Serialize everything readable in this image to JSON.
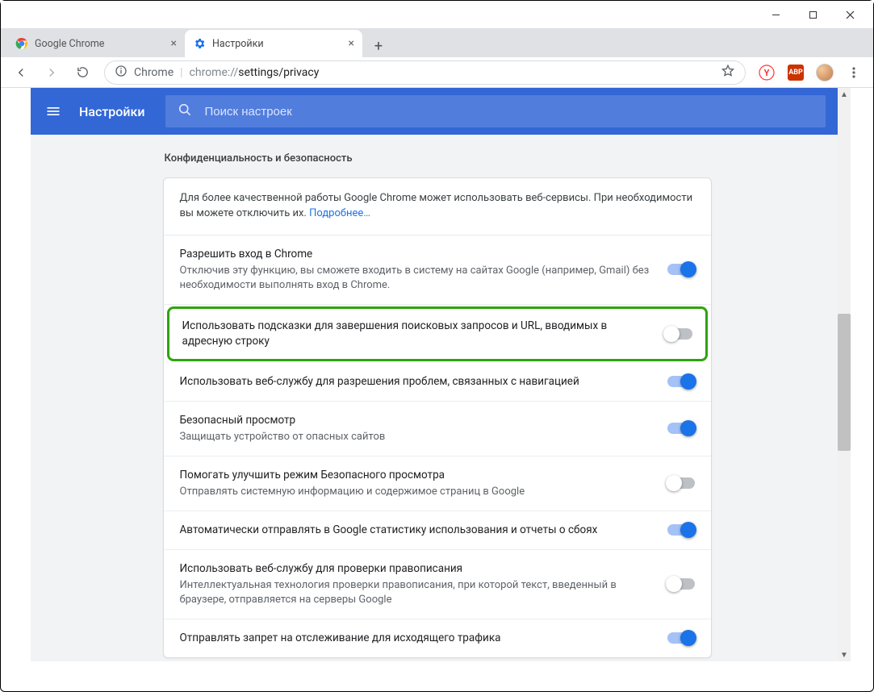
{
  "window": {
    "minimize": "—",
    "maximize": "☐",
    "close": "✕"
  },
  "tabs": [
    {
      "label": "Google Chrome",
      "active": false
    },
    {
      "label": "Настройки",
      "active": true
    }
  ],
  "toolbar": {
    "scheme_label": "Chrome",
    "url_host": "chrome://",
    "url_path": "settings/privacy",
    "yandex_icon": "Y",
    "abp_label": "ABP"
  },
  "settings": {
    "app_title": "Настройки",
    "search_placeholder": "Поиск настроек",
    "section_title": "Конфиденциальность и безопасность",
    "intro_text": "Для более качественной работы Google Chrome может использовать веб-сервисы. При необходимости вы можете отключить их. ",
    "intro_link": "Подробнее…",
    "rows": [
      {
        "title": "Разрешить вход в Chrome",
        "sub": "Отключив эту функцию, вы сможете входить в систему на сайтах Google (например, Gmail) без необходимости выполнять вход в Chrome.",
        "on": true,
        "highlight": false
      },
      {
        "title": "Использовать подсказки для завершения поисковых запросов и URL, вводимых в адресную строку",
        "sub": "",
        "on": false,
        "highlight": true
      },
      {
        "title": "Использовать веб-службу для разрешения проблем, связанных с навигацией",
        "sub": "",
        "on": true,
        "highlight": false
      },
      {
        "title": "Безопасный просмотр",
        "sub": "Защищать устройство от опасных сайтов",
        "on": true,
        "highlight": false
      },
      {
        "title": "Помогать улучшить режим Безопасного просмотра",
        "sub": "Отправлять системную информацию и содержимое страниц в Google",
        "on": false,
        "highlight": false
      },
      {
        "title": "Автоматически отправлять в Google статистику использования и отчеты о сбоях",
        "sub": "",
        "on": true,
        "highlight": false
      },
      {
        "title": "Использовать веб-службу для проверки правописания",
        "sub": "Интеллектуальная технология проверки правописания, при которой текст, введенный в браузере, отправляется на серверы Google",
        "on": false,
        "highlight": false
      },
      {
        "title": "Отправлять запрет на отслеживание для исходящего трафика",
        "sub": "",
        "on": true,
        "highlight": false
      }
    ]
  }
}
